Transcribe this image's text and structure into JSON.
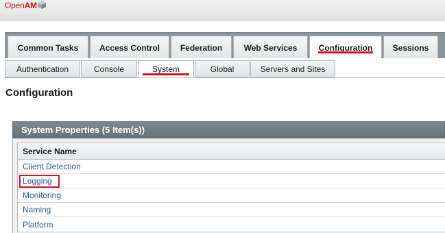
{
  "app": {
    "logo_open": "Open",
    "logo_am": "AM"
  },
  "primary_tabs": [
    {
      "label": "Common Tasks",
      "active": false
    },
    {
      "label": "Access Control",
      "active": false
    },
    {
      "label": "Federation",
      "active": false
    },
    {
      "label": "Web Services",
      "active": false
    },
    {
      "label": "Configuration",
      "active": true
    },
    {
      "label": "Sessions",
      "active": false
    }
  ],
  "secondary_tabs": [
    {
      "label": "Authentication",
      "active": false
    },
    {
      "label": "Console",
      "active": false
    },
    {
      "label": "System",
      "active": true
    },
    {
      "label": "Global",
      "active": false
    },
    {
      "label": "Servers and Sites",
      "active": false
    }
  ],
  "page": {
    "title": "Configuration"
  },
  "table": {
    "title": "System Properties (5 Item(s))",
    "column_header": "Service Name",
    "rows": [
      {
        "label": "Client Detection"
      },
      {
        "label": "Logging",
        "highlighted": true
      },
      {
        "label": "Monitoring"
      },
      {
        "label": "Naming"
      },
      {
        "label": "Platform"
      }
    ]
  },
  "colors": {
    "accent": "#d4141c",
    "link": "#2d5a9a",
    "table_header_bg": "#6f7c82",
    "tab_bar_bg": "#8a959b"
  }
}
